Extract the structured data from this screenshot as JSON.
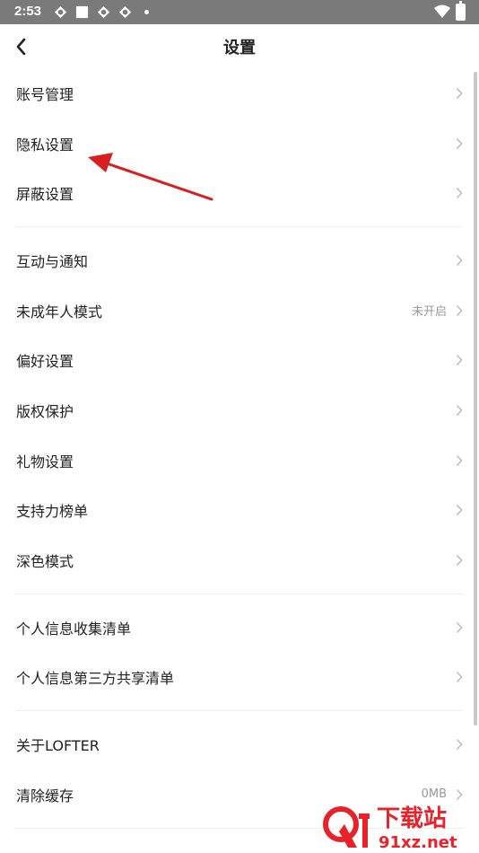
{
  "status_bar": {
    "time": "2:53"
  },
  "header": {
    "title": "设置"
  },
  "groups": [
    [
      {
        "label": "账号管理"
      },
      {
        "label": "隐私设置"
      },
      {
        "label": "屏蔽设置"
      }
    ],
    [
      {
        "label": "互动与通知"
      },
      {
        "label": "未成年人模式",
        "value": "未开启"
      },
      {
        "label": "偏好设置"
      },
      {
        "label": "版权保护"
      },
      {
        "label": "礼物设置"
      },
      {
        "label": "支持力榜单"
      },
      {
        "label": "深色模式"
      }
    ],
    [
      {
        "label": "个人信息收集清单"
      },
      {
        "label": "个人信息第三方共享清单"
      }
    ],
    [
      {
        "label": "关于LOFTER"
      },
      {
        "label": "清除缓存",
        "value": "0MB"
      }
    ]
  ],
  "watermark": {
    "text": "下载站",
    "domain": "91xz.net"
  },
  "colors": {
    "status_bar": "#7a7a7a",
    "annotation_arrow": "#d62020",
    "watermark_red": "#e8222a"
  }
}
